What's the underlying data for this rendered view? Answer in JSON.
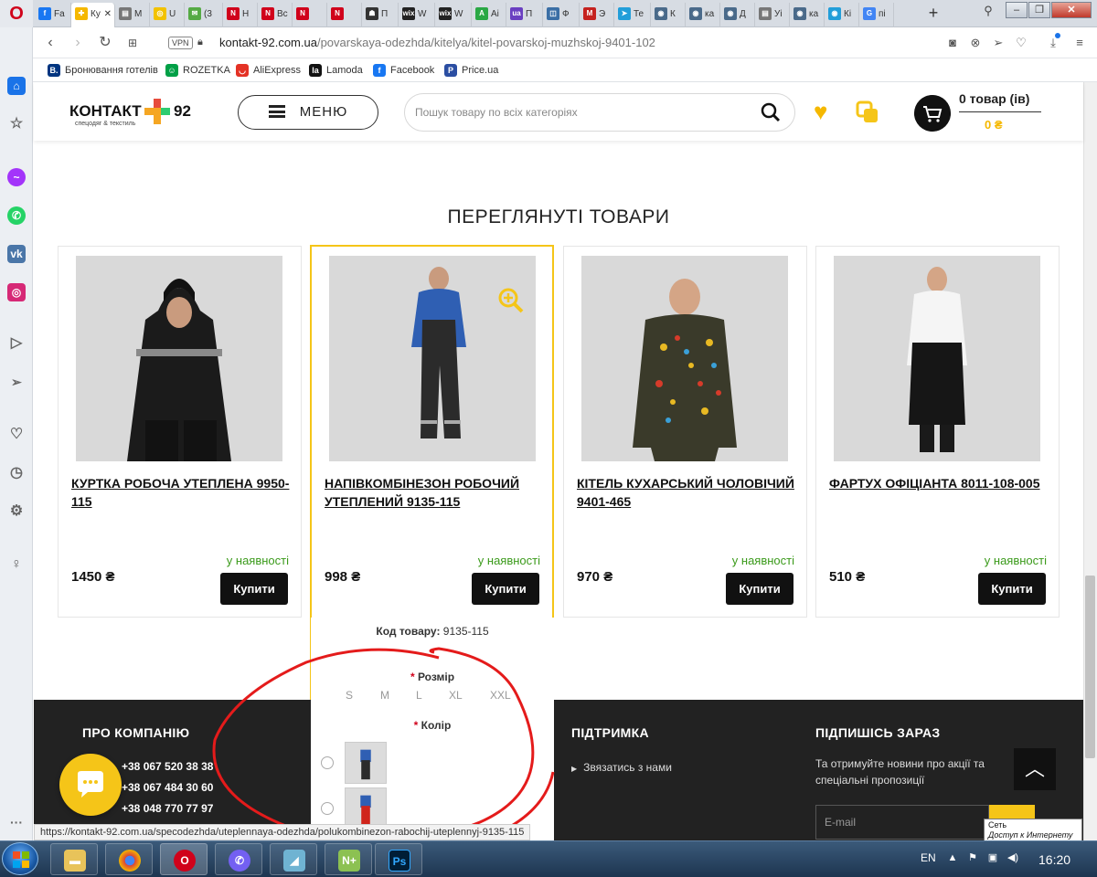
{
  "browser": {
    "tabs": [
      {
        "label": "Fa",
        "color": "#1877f2",
        "glyph": "f"
      },
      {
        "label": "Ку",
        "color": "#f5b800",
        "glyph": "✚",
        "active": true
      },
      {
        "label": "М",
        "color": "#777777",
        "glyph": "▤"
      },
      {
        "label": "U",
        "color": "#f2c200",
        "glyph": "◎"
      },
      {
        "label": "(3",
        "color": "#55aa44",
        "glyph": "✉"
      },
      {
        "label": "Н",
        "color": "#d0021b",
        "glyph": "N"
      },
      {
        "label": "Вс",
        "color": "#d0021b",
        "glyph": "N"
      },
      {
        "label": "",
        "color": "#d0021b",
        "glyph": "N"
      },
      {
        "label": "",
        "color": "#d0021b",
        "glyph": "N"
      },
      {
        "label": "П",
        "color": "#333333",
        "glyph": "☗"
      },
      {
        "label": "W",
        "color": "#222222",
        "glyph": "wix"
      },
      {
        "label": "W",
        "color": "#222222",
        "glyph": "wix"
      },
      {
        "label": "Аі",
        "color": "#2aa845",
        "glyph": "A"
      },
      {
        "label": "П",
        "color": "#6a3fc1",
        "glyph": "ua"
      },
      {
        "label": "Ф",
        "color": "#3a6ea5",
        "glyph": "◫"
      },
      {
        "label": "Э",
        "color": "#c5221f",
        "glyph": "M"
      },
      {
        "label": "Те",
        "color": "#229ed9",
        "glyph": "➤"
      },
      {
        "label": "К",
        "color": "#4a6a8a",
        "glyph": "◉"
      },
      {
        "label": "ка",
        "color": "#4a6a8a",
        "glyph": "◉"
      },
      {
        "label": "Д",
        "color": "#4a6a8a",
        "glyph": "◉"
      },
      {
        "label": "Уі",
        "color": "#777777",
        "glyph": "▤"
      },
      {
        "label": "ка",
        "color": "#4a6a8a",
        "glyph": "◉"
      },
      {
        "label": "Кі",
        "color": "#229ed9",
        "glyph": "◉"
      },
      {
        "label": "пі",
        "color": "#4285f4",
        "glyph": "G"
      }
    ],
    "new_tab": "+",
    "url_domain": "kontakt-92.com.ua",
    "url_path": "/povarskaya-odezhda/kitelya/kitel-povarskoj-muzhskoj-9401-102",
    "vpn": "VPN",
    "bookmarks": [
      {
        "label": "Бронювання готелів",
        "color": "#003580",
        "glyph": "B."
      },
      {
        "label": "ROZETKA",
        "color": "#00a046",
        "glyph": "☺"
      },
      {
        "label": "AliExpress",
        "color": "#e43225",
        "glyph": "◡"
      },
      {
        "label": "Lamoda",
        "color": "#111111",
        "glyph": "la"
      },
      {
        "label": "Facebook",
        "color": "#1877f2",
        "glyph": "f"
      },
      {
        "label": "Price.ua",
        "color": "#2b4ea2",
        "glyph": "P"
      }
    ],
    "status_url": "https://kontakt-92.com.ua/specodezhda/uteplennaya-odezhda/polukombinezon-rabochij-uteplennyj-9135-115",
    "net_tooltip_title": "Сеть",
    "net_tooltip_text": "Доступ к Интернету"
  },
  "site": {
    "logo_text": "КОНТАКТ",
    "logo_num": "92",
    "logo_sub": "спецодяг & текстиль",
    "menu_label": "МЕНЮ",
    "search_placeholder": "Пошук товару по всіх категоріях",
    "cart_count": "0 товар (ів)",
    "cart_sum": "0 ₴",
    "accent": "#f5c518"
  },
  "viewed": {
    "title": "ПЕРЕГЛЯНУТІ ТОВАРИ",
    "products": [
      {
        "name": "КУРТКА РОБОЧА УТЕПЛЕНА 9950-115",
        "availability": "у наявності",
        "price": "1450 ₴",
        "buy": "Купити",
        "image": "worker-in-black-winter-jacket"
      },
      {
        "name": "НАПІВКОМБІНЕЗОН РОБОЧИЙ УТЕПЛЕНИЙ 9135-115",
        "availability": "у наявності",
        "price": "998 ₴",
        "buy": "Купити",
        "image": "worker-in-bib-overalls"
      },
      {
        "name": "КІТЕЛЬ КУХАРСЬКИЙ ЧОЛОВІЧИЙ 9401-465",
        "availability": "у наявності",
        "price": "970 ₴",
        "buy": "Купити",
        "image": "chef-in-print-jacket"
      },
      {
        "name": "ФАРТУХ ОФІЦІАНТА 8011-108-005",
        "availability": "у наявності",
        "price": "510 ₴",
        "buy": "Купити",
        "image": "waiter-in-black-apron"
      }
    ],
    "hover": {
      "code_label": "Код товару:",
      "code_value": "9135-115",
      "required_mark": "*",
      "size_label": "Розмір",
      "sizes": [
        "S",
        "M",
        "L",
        "XL",
        "XXL"
      ],
      "color_label": "Колір"
    }
  },
  "footer": {
    "about_title": "ПРО КОМПАНІЮ",
    "phones": [
      "+38 067 520 38 38",
      "+38 067 484 30 60",
      "+38 048 770 77 97"
    ],
    "support_title": "ПІДТРИМКА",
    "support_link": "Звязатись з нами",
    "subscribe_title": "ПІДПИШІСЬ ЗАРАЗ",
    "subscribe_text": "Та отримуйте новини про акції та спеціальні пропозиції",
    "email_placeholder": "E-mail"
  },
  "taskbar": {
    "lang": "EN",
    "clock": "16:20"
  }
}
